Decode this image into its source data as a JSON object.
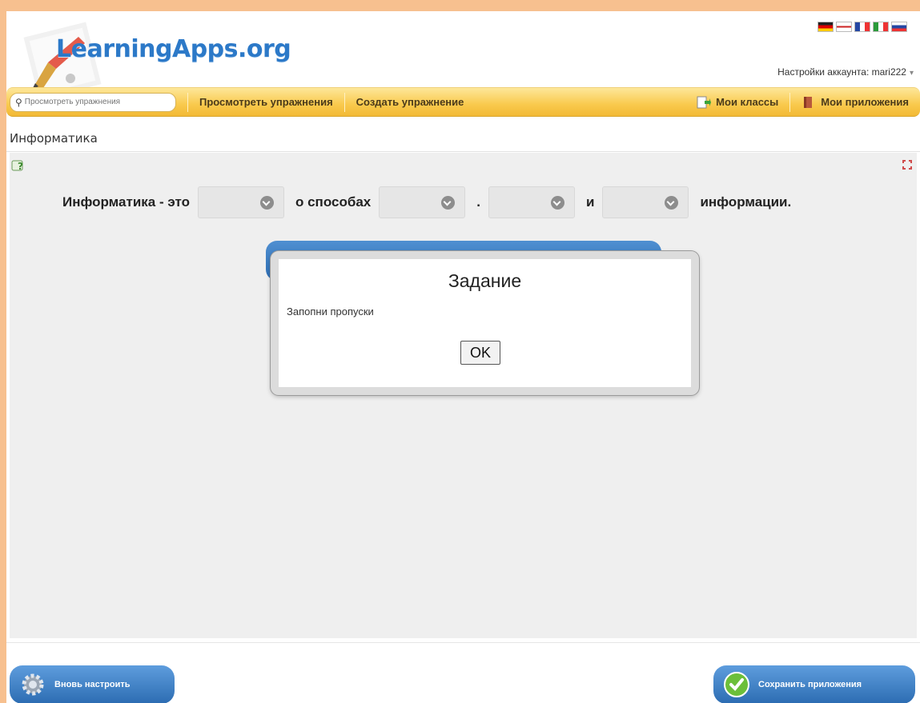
{
  "header": {
    "logo_text": "LearningApps.org",
    "account_label": "Настройки аккаунта: mari222",
    "languages": [
      "de",
      "en",
      "fr",
      "it",
      "ru"
    ]
  },
  "nav": {
    "search_placeholder": "Просмотреть упражнения",
    "items": [
      {
        "label": "Просмотреть упражнения"
      },
      {
        "label": "Создать упражнение"
      },
      {
        "label": "Мои классы",
        "icon": "class-icon"
      },
      {
        "label": "Мои приложения",
        "icon": "book-icon"
      }
    ]
  },
  "page": {
    "title": "Информатика"
  },
  "exercise": {
    "parts": [
      "Информатика - это",
      "о способах",
      ".",
      "и",
      "информации."
    ],
    "dropdowns": [
      "",
      "",
      "",
      ""
    ]
  },
  "dialog": {
    "title": "Задание",
    "text": "Запопни пропуски",
    "ok_label": "OK"
  },
  "footer": {
    "reconfigure_label": "Вновь настроить",
    "save_label": "Сохранить приложения"
  },
  "colors": {
    "page_border": "#f7c08f",
    "nav_yellow": "#f9c94c",
    "logo_blue": "#2c79c8",
    "button_blue": "#2c6cb2"
  }
}
